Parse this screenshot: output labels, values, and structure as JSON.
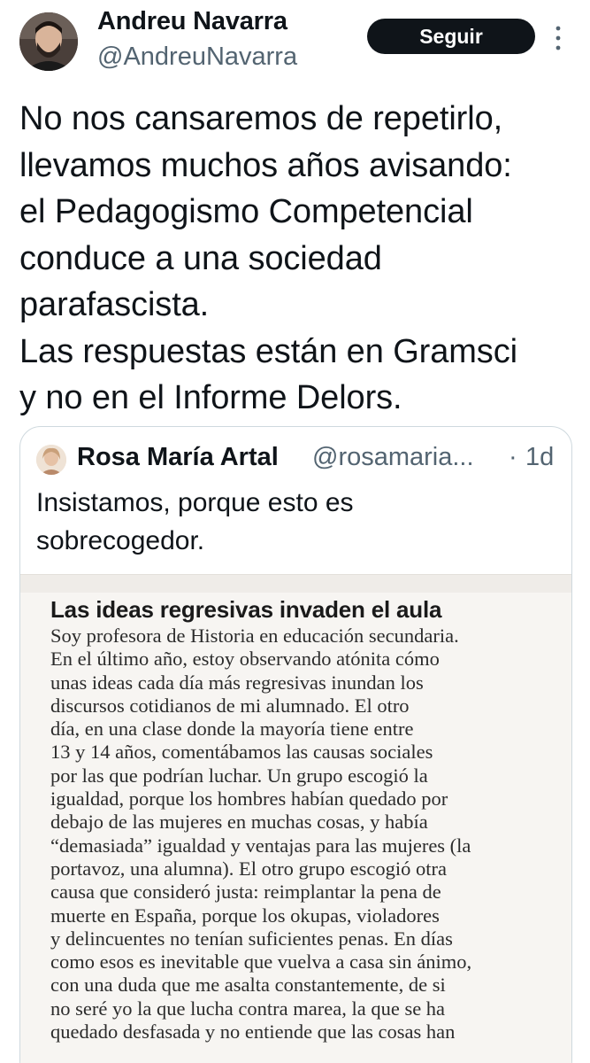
{
  "author": {
    "name": "Andreu Navarra",
    "handle": "@AndreuNavarra"
  },
  "follow_button": "Seguir",
  "more_icon": "vertical-ellipsis-icon",
  "tweet": {
    "lines": [
      "No nos cansaremos de repetirlo,",
      "llevamos muchos años avisando:",
      "el Pedagogismo Competencial",
      "conduce a una sociedad",
      "parafascista.",
      "Las respuestas están en Gramsci",
      "y no en el Informe Delors."
    ]
  },
  "quoted": {
    "name": "Rosa María Artal",
    "handle": "@rosamaria...",
    "separator": "·",
    "time": "1d",
    "text_lines": [
      "Insistamos, porque esto es",
      "sobrecogedor."
    ],
    "clipping": {
      "title": "Las ideas regresivas invaden el aula",
      "lines": [
        "Soy profesora de Historia en educación secundaria.",
        "En el último año, estoy observando atónita cómo",
        "unas ideas cada día más regresivas inundan los",
        "discursos cotidianos de mi alumnado. El otro",
        "día, en una clase donde la mayoría tiene entre",
        "13 y 14 años, comentábamos las causas sociales",
        "por las que podrían luchar. Un grupo escogió la",
        "igualdad, porque los hombres habían quedado por",
        "debajo de las mujeres en muchas cosas, y había",
        "“demasiada” igualdad y ventajas para las mujeres (la",
        "portavoz, una alumna). El otro grupo escogió otra",
        "causa que consideró justa: reimplantar la pena de",
        "muerte en España, porque los okupas, violadores",
        "y delincuentes no tenían suficientes penas. En días",
        "como esos es inevitable que vuelva a casa sin ánimo,",
        "con una duda que me asalta constantemente, de si",
        "no seré yo la que lucha contra marea, la que se ha",
        "quedado desfasada y no entiende que las cosas han"
      ]
    }
  }
}
